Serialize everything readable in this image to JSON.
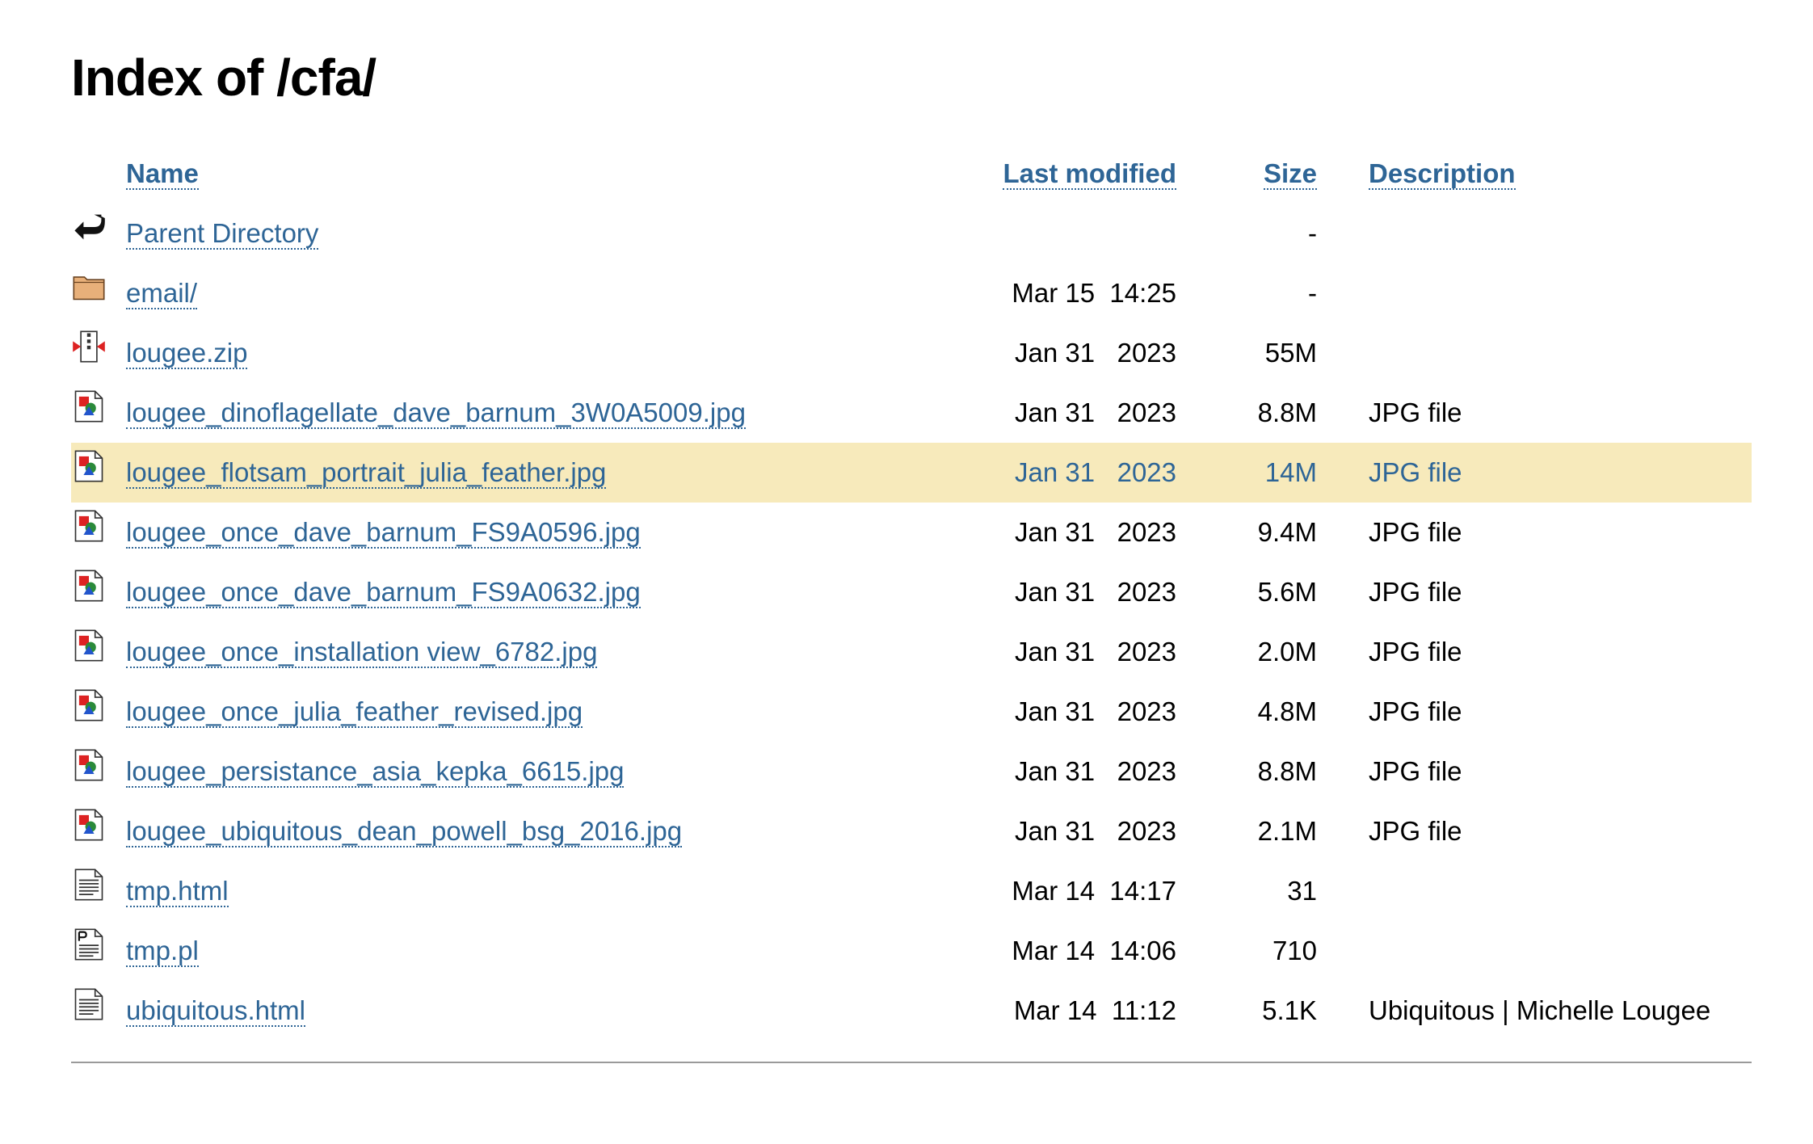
{
  "title": "Index of /cfa/",
  "columns": {
    "name": "Name",
    "modified": "Last modified",
    "size": "Size",
    "description": "Description"
  },
  "rows": [
    {
      "icon": "back-icon",
      "name": "Parent Directory",
      "modified": "",
      "size": "-",
      "description": ""
    },
    {
      "icon": "folder-icon",
      "name": "email/",
      "modified": "Mar 15  14:25",
      "size": "-",
      "description": ""
    },
    {
      "icon": "compressed-icon",
      "name": "lougee.zip",
      "modified": "Jan 31   2023",
      "size": "55M",
      "description": ""
    },
    {
      "icon": "image-icon",
      "name": "lougee_dinoflagellate_dave_barnum_3W0A5009.jpg",
      "modified": "Jan 31   2023",
      "size": "8.8M",
      "description": "JPG file"
    },
    {
      "icon": "image-icon",
      "name": "lougee_flotsam_portrait_julia_feather.jpg",
      "modified": "Jan 31   2023",
      "size": "14M",
      "description": "JPG file",
      "highlight": true
    },
    {
      "icon": "image-icon",
      "name": "lougee_once_dave_barnum_FS9A0596.jpg",
      "modified": "Jan 31   2023",
      "size": "9.4M",
      "description": "JPG file"
    },
    {
      "icon": "image-icon",
      "name": "lougee_once_dave_barnum_FS9A0632.jpg",
      "modified": "Jan 31   2023",
      "size": "5.6M",
      "description": "JPG file"
    },
    {
      "icon": "image-icon",
      "name": "lougee_once_installation view_6782.jpg",
      "modified": "Jan 31   2023",
      "size": "2.0M",
      "description": "JPG file"
    },
    {
      "icon": "image-icon",
      "name": "lougee_once_julia_feather_revised.jpg",
      "modified": "Jan 31   2023",
      "size": "4.8M",
      "description": "JPG file"
    },
    {
      "icon": "image-icon",
      "name": "lougee_persistance_asia_kepka_6615.jpg",
      "modified": "Jan 31   2023",
      "size": "8.8M",
      "description": "JPG file"
    },
    {
      "icon": "image-icon",
      "name": "lougee_ubiquitous_dean_powell_bsg_2016.jpg",
      "modified": "Jan 31   2023",
      "size": "2.1M",
      "description": "JPG file"
    },
    {
      "icon": "text-file-icon",
      "name": "tmp.html",
      "modified": "Mar 14  14:17",
      "size": "31",
      "description": ""
    },
    {
      "icon": "script-file-icon",
      "name": "tmp.pl",
      "modified": "Mar 14  14:06",
      "size": "710",
      "description": ""
    },
    {
      "icon": "text-file-icon",
      "name": "ubiquitous.html",
      "modified": "Mar 14  11:12",
      "size": "5.1K",
      "description": "Ubiquitous | Michelle Lougee"
    }
  ],
  "colors": {
    "link": "#2e6596",
    "highlight_row": "#f7eabb",
    "separator": "#9a9a9a"
  }
}
